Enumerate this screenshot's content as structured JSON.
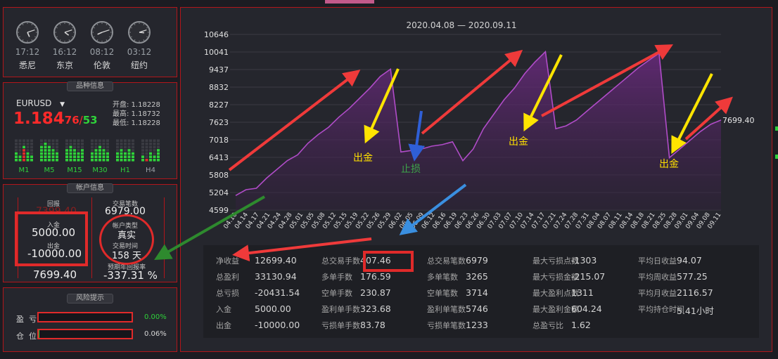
{
  "clocks": [
    {
      "time": "17:12",
      "city": "悉尼",
      "h": 5,
      "m": 12
    },
    {
      "time": "16:12",
      "city": "东京",
      "h": 4,
      "m": 12
    },
    {
      "time": "08:12",
      "city": "伦敦",
      "h": 8,
      "m": 12
    },
    {
      "time": "03:12",
      "city": "纽约",
      "h": 3,
      "m": 12
    }
  ],
  "symbol": {
    "section": "品种信息",
    "name": "EURUSD",
    "price_main": "1.184",
    "price_sub1": "76",
    "price_sep": "/",
    "price_sub2": "53",
    "open": "开盘: 1.18228",
    "high": "最高: 1.18732",
    "low": "最低: 1.18228",
    "timeframes": [
      "M1",
      "M5",
      "M15",
      "M30",
      "H1",
      "H4"
    ]
  },
  "account": {
    "section": "帐户信息",
    "return_label": "回报",
    "return_value": "7399.40",
    "deposit_label": "入金",
    "deposit_value": "5000.00",
    "withdraw_label": "出金",
    "withdraw_value": "-10000.00",
    "balance_value": "7699.40",
    "trades_label": "交易笔数",
    "trades_value": "6979.00",
    "acct_type_label": "帐户类型",
    "acct_type_value": "真实",
    "trade_time_label": "交易时间",
    "trade_time_value": "158 天",
    "annual_label": "预期年回报率",
    "annual_value": "-337.31 %"
  },
  "risk": {
    "section": "风险提示",
    "profit_label": "盈  亏",
    "profit_value": "0.00%",
    "position_label": "仓  位",
    "position_value": "0.06%"
  },
  "chart_data": {
    "type": "area",
    "title": "2020.04.08 — 2020.09.11",
    "y_ticks": [
      "10646",
      "10041",
      "9437",
      "8832",
      "8227",
      "7623",
      "7018",
      "6413",
      "5808",
      "5204",
      "4599"
    ],
    "ylim": [
      4599,
      10646
    ],
    "x_labels": [
      "04.10",
      "04.14",
      "04.17",
      "04.21",
      "04.24",
      "04.28",
      "05.01",
      "05.05",
      "05.08",
      "05.12",
      "05.15",
      "05.19",
      "05.22",
      "05.26",
      "05.29",
      "06.02",
      "06.05",
      "06.09",
      "06.12",
      "06.16",
      "06.19",
      "06.23",
      "06.26",
      "06.30",
      "07.03",
      "07.07",
      "07.10",
      "07.14",
      "07.17",
      "07.21",
      "07.24",
      "07.28",
      "07.31",
      "08.04",
      "08.07",
      "08.11",
      "08.14",
      "08.18",
      "08.21",
      "08.25",
      "08.28",
      "09.01",
      "09.04",
      "09.08",
      "09.11"
    ],
    "last_value_label": "7699.40",
    "series": [
      {
        "values": [
          5100,
          5300,
          5350,
          5700,
          6000,
          6300,
          6500,
          6900,
          7200,
          7450,
          7800,
          8100,
          8450,
          8800,
          9200,
          9450,
          6600,
          6650,
          6700,
          6800,
          6850,
          6950,
          6300,
          6700,
          7400,
          7900,
          8400,
          8800,
          9300,
          9700,
          10050,
          7400,
          7500,
          7700,
          8000,
          8300,
          8600,
          8900,
          9200,
          9500,
          9750,
          10000,
          6400,
          6700,
          7000,
          7300,
          7550,
          7699
        ]
      }
    ],
    "grid": true,
    "annotations": [
      {
        "text": "出金",
        "color": "#ffe000"
      },
      {
        "text": "止损",
        "color": "#3ea54a"
      },
      {
        "text": "出金",
        "color": "#ffe000"
      },
      {
        "text": "出金",
        "color": "#ffe000"
      }
    ]
  },
  "stats": {
    "cols": [
      [
        {
          "label": "净收益",
          "value": "12699.40"
        },
        {
          "label": "总盈利",
          "value": "33130.94"
        },
        {
          "label": "总亏损",
          "value": "-20431.54"
        },
        {
          "label": "入金",
          "value": "5000.00"
        },
        {
          "label": "出金",
          "value": "-10000.00"
        }
      ],
      [
        {
          "label": "总交易手数",
          "value": "407.46"
        },
        {
          "label": "多单手数",
          "value": "176.59"
        },
        {
          "label": "空单手数",
          "value": "230.87"
        },
        {
          "label": "盈利单手数",
          "value": "323.68"
        },
        {
          "label": "亏损单手数",
          "value": "83.78"
        }
      ],
      [
        {
          "label": "总交易笔数",
          "value": "6979"
        },
        {
          "label": "多单笔数",
          "value": "3265"
        },
        {
          "label": "空单笔数",
          "value": "3714"
        },
        {
          "label": "盈利单笔数",
          "value": "5746"
        },
        {
          "label": "亏损单笔数",
          "value": "1233"
        }
      ],
      [
        {
          "label": "最大亏损点数",
          "value": "-1303"
        },
        {
          "label": "最大亏损金额",
          "value": "-215.07"
        },
        {
          "label": "最大盈利点数",
          "value": "1311"
        },
        {
          "label": "最大盈利金额",
          "value": "604.24"
        },
        {
          "label": "总盈亏比",
          "value": "1.62"
        }
      ],
      [
        {
          "label": "平均日收益",
          "value": "94.07"
        },
        {
          "label": "平均周收益",
          "value": "577.25"
        },
        {
          "label": "平均月收益",
          "value": "2116.57"
        },
        {
          "label": "平均持仓时间",
          "value": "5.41小时"
        }
      ]
    ]
  }
}
